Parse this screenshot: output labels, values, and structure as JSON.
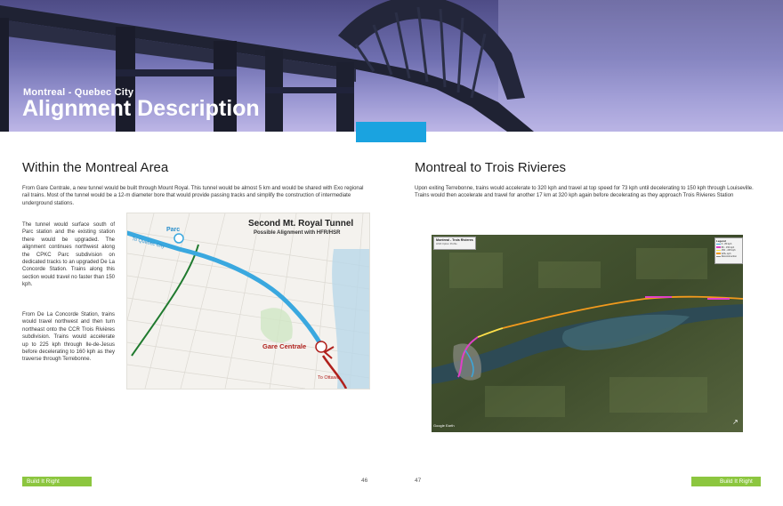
{
  "header": {
    "subtitle": "Montreal - Quebec City",
    "title": "Alignment Description"
  },
  "left": {
    "heading": "Within the Montreal Area",
    "intro": "From Gare Centrale, a new tunnel would be built through Mount Royal. This tunnel would be almost 5 km and would be shared with Exo regional rail trains. Most of the tunnel would be a 12-m diameter bore that would provide passing tracks and simplify the construction of intermediate underground stations.",
    "para1": "The tunnel would surface south of Parc station and the existing station there would be upgraded. The alignment continues northwest along the CPKC Parc subdivision on dedicated tracks to an upgraded De La Concorde Station. Trains along this section would travel no faster than 150 kph.",
    "para2": "From De La Concorde Station, trains would travel northwest and then turn northeast onto the CCR Trois Rivières subdivision. Trains would accelerate up to 225 kph through Ile-de-Jesus before decelerating to 160 kph as they traverse through Terrebonne.",
    "map": {
      "title": "Second Mt. Royal Tunnel",
      "subtitle": "Possible Alignment with HFR/HSR",
      "label_parc": "Parc",
      "label_quebec": "To Quebec City",
      "label_gare": "Gare Centrale",
      "label_ottawa": "To Ottawa"
    }
  },
  "right": {
    "heading": "Montreal to Trois Rivieres",
    "intro": "Upon exiting Terrebonne, trains would accelerate to 320 kph and travel at top speed for 73 kph until decelerating to 150 kph through Louiseville. Trains would then accelerate and travel for another 17 km at 320 kph again before decelerating as they approach Trois Rivieres Station",
    "map": {
      "title": "Montreal - Trois Rivieres",
      "subtitle": "HSR Option Profile",
      "legend_title": "Legend",
      "legend": [
        "0 - 80 kph",
        "80 - 150 kph",
        "150 - 225 kph",
        "225+ kph",
        "Reconstruction"
      ],
      "credit": "Google Earth"
    }
  },
  "footer": {
    "left_label": "Build It Right",
    "right_label": "Build It Right",
    "page_left": "46",
    "page_right": "47"
  },
  "colors": {
    "green": "#8cc63f",
    "blue": "#1aa3e0",
    "route_blue": "#3aa8df",
    "route_red": "#b0201c",
    "route_green": "#1f7a2e",
    "route_orange": "#f29a1d"
  }
}
